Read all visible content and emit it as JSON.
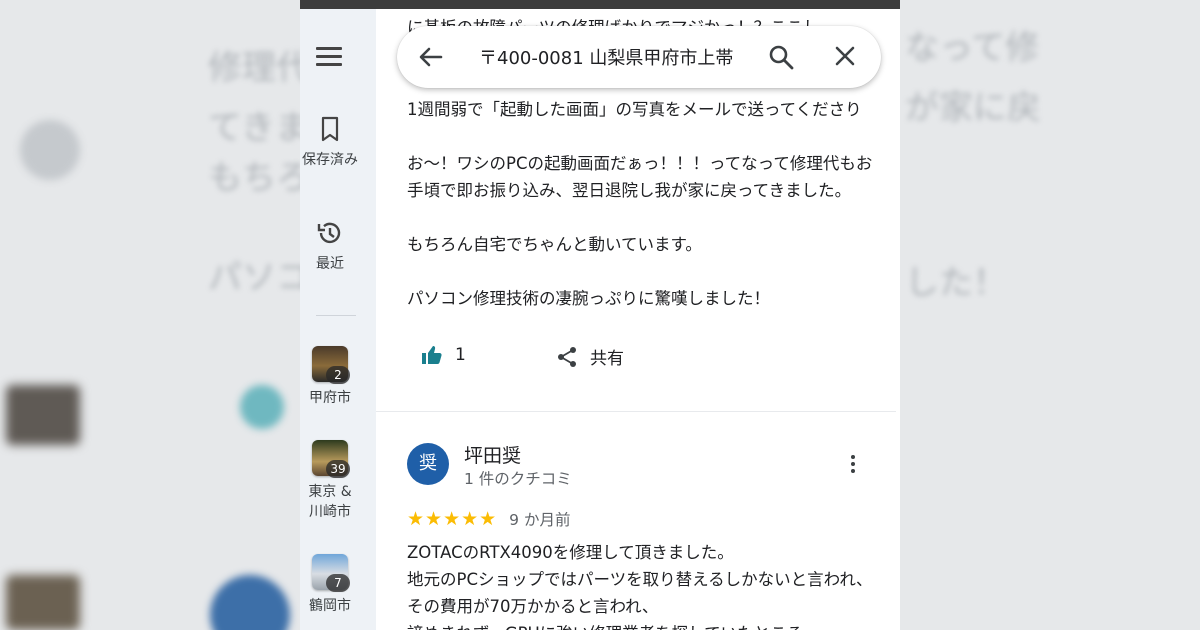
{
  "search": {
    "query": "〒400-0081 山梨県甲府市上帯",
    "icons": {
      "back": "arrow-left-icon",
      "search": "magnifier-icon",
      "close": "close-icon"
    }
  },
  "rail": {
    "menu_icon": "hamburger-menu-icon",
    "saved_label": "保存済み",
    "recent_label": "最近",
    "places": [
      {
        "count": "2",
        "label": "甲府市"
      },
      {
        "count": "39",
        "label": "東京 & 川崎市"
      },
      {
        "count": "7",
        "label": "鶴岡市"
      }
    ]
  },
  "review1": {
    "partial_line": "に基板の故障パーツの修理ばかりでマジかっ！？ここし",
    "lines": [
      "1週間弱で「起動した画面」の写真をメールで送ってくださり",
      "お〜！ワシのPCの起動画面だぁっ！！！ってなって修理代もお手頃で即お振り込み、翌日退院し我が家に戻ってきました。",
      "もちろん自宅でちゃんと動いています。",
      "",
      "パソコン修理技術の凄腕っぷりに驚嘆しました！"
    ],
    "like_count": "1",
    "share_label": "共有"
  },
  "review2": {
    "avatar_letter": "奨",
    "name": "坪田奨",
    "review_count": "1 件のクチコミ",
    "stars": "★★★★★",
    "rating": 5,
    "date": "9 か月前",
    "lines": [
      "ZOTACのRTX4090を修理して頂きました。",
      "地元のPCショップではパーツを取り替えるしかないと言われ、その費用が70万かかると言われ、",
      "諦めきれず、GPUに強い修理業者を探していたところ"
    ]
  },
  "colors": {
    "accent_blue": "#1f5fa8",
    "star": "#fbbc04",
    "thumb_icon": "#1a7f8e"
  }
}
